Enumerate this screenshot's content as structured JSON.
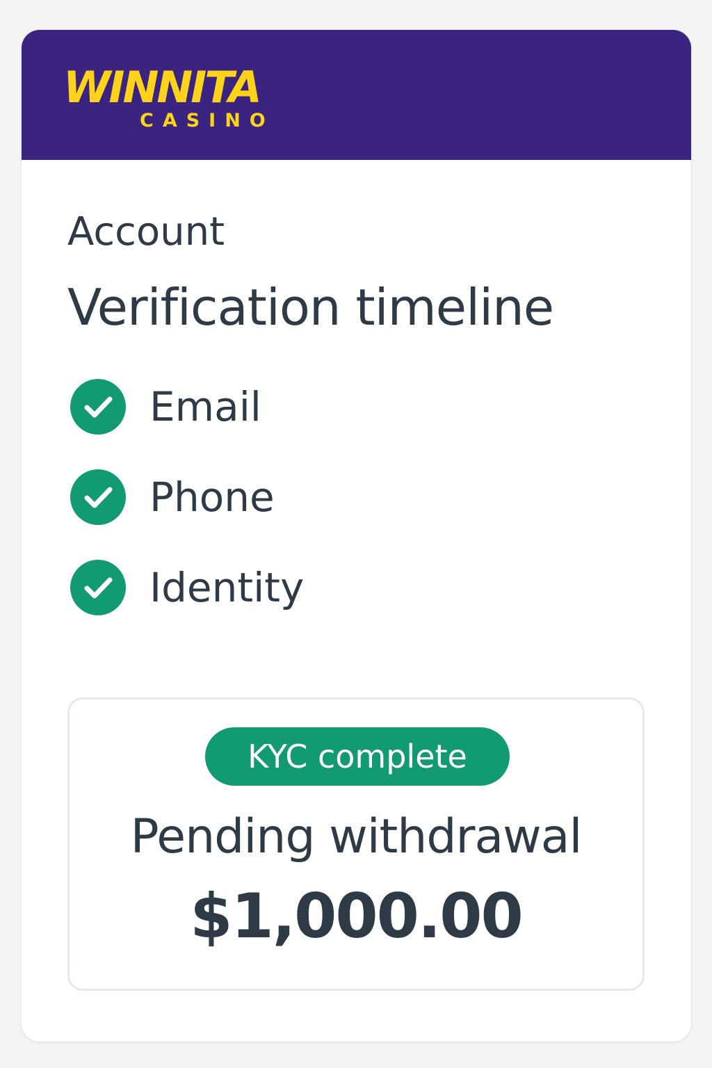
{
  "brand": {
    "name": "WINNITA",
    "sub": "CASINO",
    "colors": {
      "bar": "#3b2380",
      "logo": "#ffd31a"
    }
  },
  "section_label": "Account",
  "title": "Verification timeline",
  "steps": [
    {
      "label": "Email",
      "status": "complete",
      "icon": "check-circle-icon"
    },
    {
      "label": "Phone",
      "status": "complete",
      "icon": "check-circle-icon"
    },
    {
      "label": "Identity",
      "status": "complete",
      "icon": "check-circle-icon"
    }
  ],
  "status_card": {
    "badge": "KYC complete",
    "title": "Pending withdrawal",
    "amount": "$1,000.00"
  },
  "colors": {
    "accent": "#129a73",
    "text": "#2f3a47"
  }
}
